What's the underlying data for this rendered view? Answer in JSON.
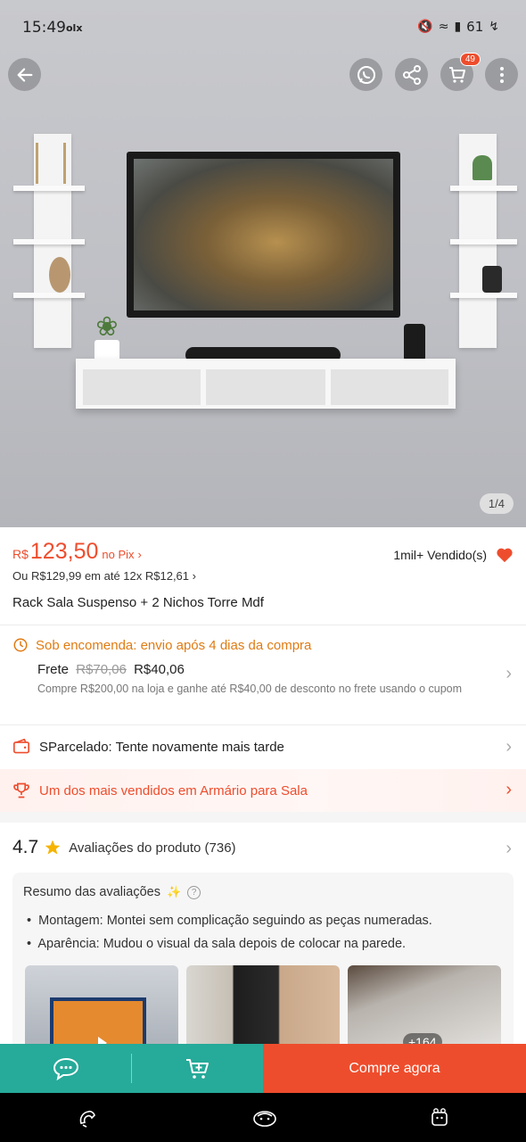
{
  "status_bar": {
    "time": "15:49",
    "app_tag": "olx",
    "battery": "61"
  },
  "header": {
    "cart_badge": "49"
  },
  "gallery": {
    "counter": "1/4"
  },
  "price": {
    "currency": "R$",
    "value": "123,50",
    "suffix": "no Pix",
    "installment": "Ou R$129,99 em até 12x R$12,61",
    "sold": "1mil+ Vendido(s)"
  },
  "product": {
    "title": "Rack Sala Suspenso + 2 Nichos Torre Mdf"
  },
  "shipping": {
    "heading": "Sob encomenda: envio após 4 dias da compra",
    "frete_label": "Frete",
    "frete_old": "R$70,06",
    "frete_new": "R$40,06",
    "description": "Compre R$200,00 na loja e ganhe até R$40,00 de desconto no frete usando o cupom"
  },
  "sparcelado": {
    "text": "SParcelado: Tente novamente mais tarde"
  },
  "bestseller": {
    "text": "Um dos mais vendidos em Armário para Sala"
  },
  "ratings": {
    "score": "4.7",
    "label": "Avaliações do produto (736)",
    "summary_title": "Resumo das avaliações",
    "bullets": [
      "Montagem: Montei sem complicação seguindo as peças numeradas.",
      "Aparência: Mudou o visual da sala depois de colocar na parede."
    ],
    "more_count": "+164"
  },
  "bottom_bar": {
    "buy_now": "Compre agora"
  },
  "colors": {
    "brand": "#ee4d2d",
    "teal": "#26aa99",
    "warning": "#e07b12"
  }
}
